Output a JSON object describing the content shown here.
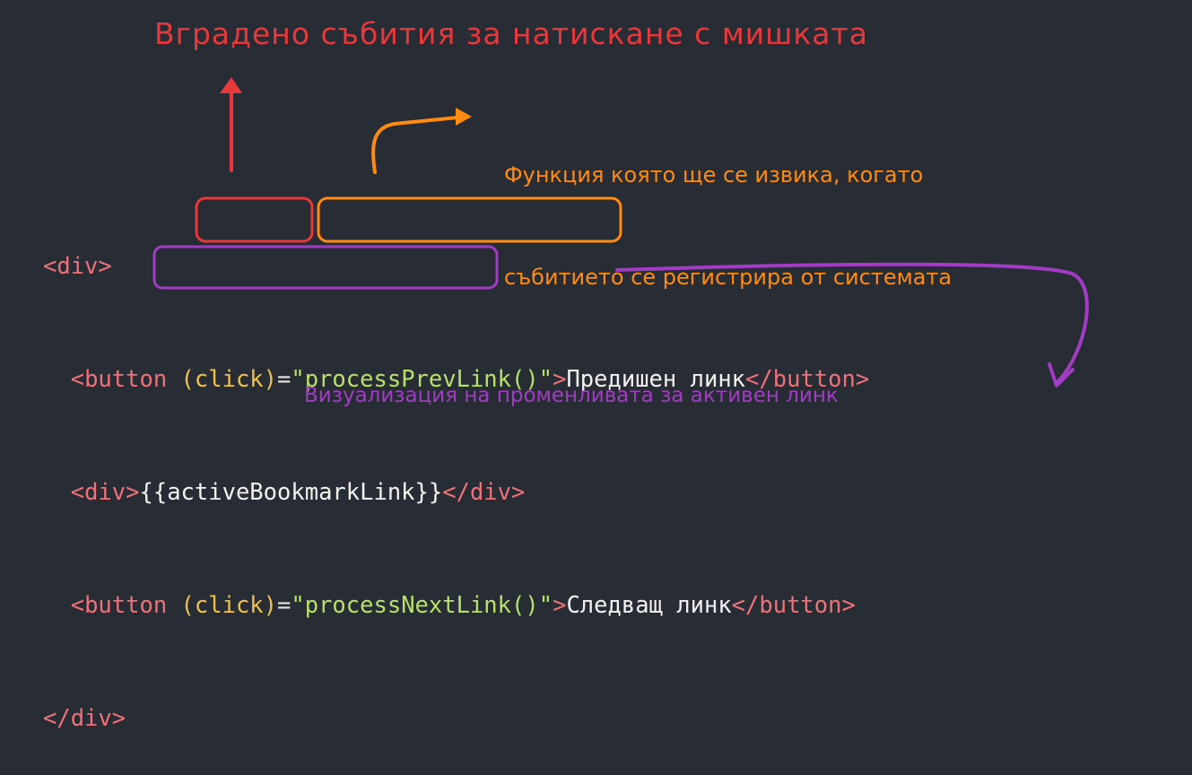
{
  "annotations": {
    "click_event": "Вградено събития за натискане с мишката",
    "handler_line1": "Функция която ще се извика, когато",
    "handler_line2": "събитието се регистрира от системата",
    "binding": "Визуализация на променливата за активен линк"
  },
  "code": {
    "line1": {
      "open": "<div>"
    },
    "line2": {
      "indent": "  ",
      "open_tag": "<button",
      "space": " ",
      "attr": "(click)",
      "eq": "=",
      "value": "\"processPrevLink()\"",
      "close_bracket": ">",
      "text": "Предишен линк",
      "close_tag": "</button>"
    },
    "line3": {
      "indent": "  ",
      "open_tag": "<div>",
      "interpolation": "{{activeBookmarkLink}}",
      "close_tag": "</div>"
    },
    "line4": {
      "indent": "  ",
      "open_tag": "<button",
      "space": " ",
      "attr": "(click)",
      "eq": "=",
      "value": "\"processNextLink()\"",
      "close_bracket": ">",
      "text": "Следващ линк",
      "close_tag": "</button>"
    },
    "line5": {
      "close": "</div>"
    }
  },
  "colors": {
    "background": "#282c34",
    "tag": "#f07178",
    "attribute": "#f0c14b",
    "string": "#b8e06a",
    "text": "#f2f2f2",
    "annotation_red": "#e8383b",
    "annotation_orange": "#ff8c10",
    "annotation_purple": "#a23cc4"
  }
}
